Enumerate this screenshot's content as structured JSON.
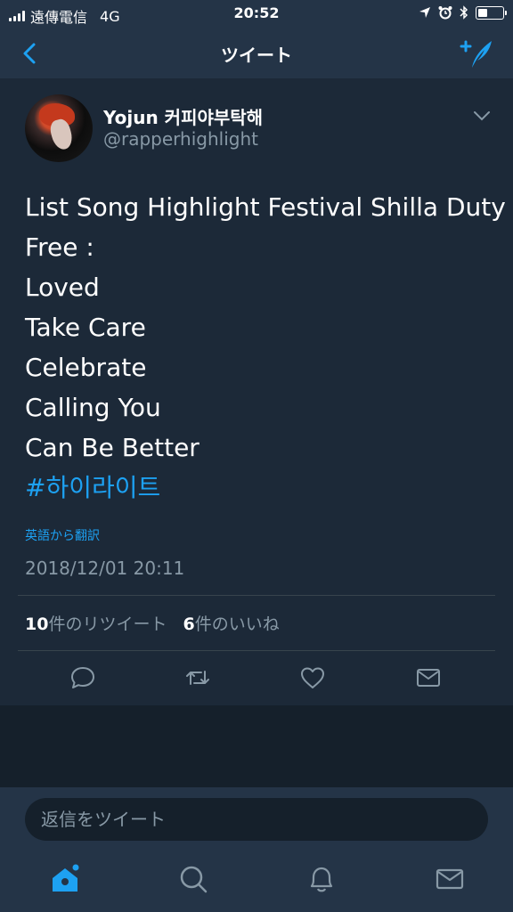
{
  "status": {
    "carrier": "遠傳電信",
    "network": "4G",
    "time": "20:52"
  },
  "nav": {
    "title": "ツイート"
  },
  "tweet": {
    "display_name": "Yojun 커피야부탁해",
    "handle": "@rapperhighlight",
    "lines": [
      "List Song Highlight Festival Shilla Duty",
      "Free :",
      "Loved",
      "Take Care",
      "Celebrate",
      "Calling You",
      "Can Be Better"
    ],
    "hashtag": "#하이라이트",
    "translate_label": "英語から翻訳",
    "timestamp": "2018/12/01 20:11",
    "retweet_count": "10",
    "retweet_label": "件のリツイート",
    "like_count": "6",
    "like_label": "件のいいね"
  },
  "reply": {
    "placeholder": "返信をツイート"
  },
  "tabs": [
    "home-icon",
    "search-icon",
    "notifications-icon",
    "messages-icon"
  ],
  "colors": {
    "background": "#15202b",
    "card": "#1c2938",
    "bars": "#243447",
    "accent": "#1da1f2",
    "secondary_text": "#8899a6"
  }
}
